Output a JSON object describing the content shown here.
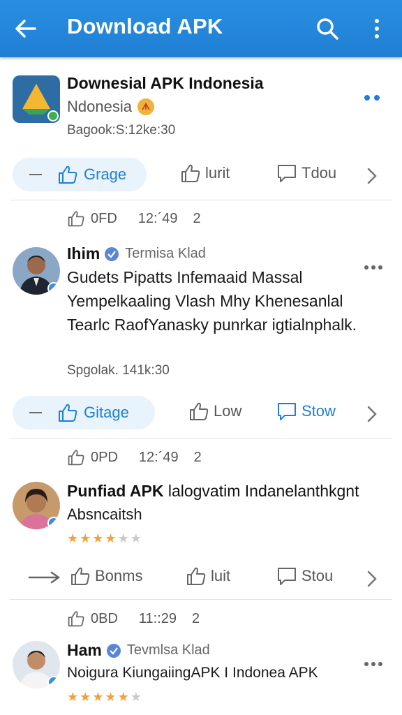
{
  "appbar": {
    "title": "Download APK"
  },
  "app": {
    "name": "Downesial APK Indonesia",
    "subtitle": "Ndonesia",
    "coin_glyph": "ᗑ",
    "meta": "Bagook:S:12ke:30"
  },
  "actions1": {
    "pill_label": "Grage",
    "like_label": "lurit",
    "comment_label": "Tdou"
  },
  "stats1": {
    "value": "0FD",
    "time": "12:´49",
    "count": "2"
  },
  "post1": {
    "name": "Ihim",
    "role": "Termisa Klad",
    "body": "Gudets Pipatts Infemaaid Massal Yempelkaaling Vlash Mhy Khenesanlal Tearlc RaofYanasky punrkar igtialnphalk.",
    "meta": "Spgolak. 141k:30"
  },
  "actions2": {
    "pill_label": "Gitage",
    "like_label": "Low",
    "comment_label": "Stow"
  },
  "stats2": {
    "value": "0PD",
    "time": "12:´49",
    "count": "2"
  },
  "post2": {
    "name": "Punfiad APK",
    "title_rest": " lalogvatim Indanelanthkgnt",
    "subtitle": "Absncaitsh",
    "rating": 3.5
  },
  "actions3": {
    "first_label": "Bonms",
    "like_label": "luit",
    "comment_label": "Stou"
  },
  "stats3": {
    "value": "0BD",
    "time": "11::29",
    "count": "2"
  },
  "post3": {
    "name": "Ham",
    "role": "Tevmlsa Klad",
    "body": "Noigura KiungaiingAPK I Indonea APK",
    "rating": 4.5
  },
  "colors": {
    "brand": "#1f7fd4",
    "pill_bg": "#e8f3fb",
    "star": "#f2a23a",
    "star_empty": "#c9c9c9"
  }
}
